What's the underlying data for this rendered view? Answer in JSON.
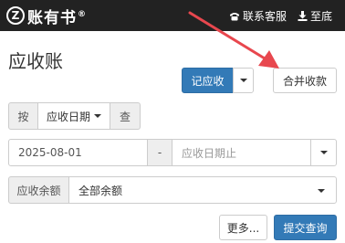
{
  "header": {
    "logo_mark": "Z",
    "logo_text": "账有书",
    "logo_reg": "®",
    "service_label": "联系客服",
    "bottom_label": "至底"
  },
  "page": {
    "title": "应收账"
  },
  "toolbar": {
    "record_label": "记应收",
    "merge_label": "合并收款"
  },
  "filter": {
    "by_label": "按",
    "by_value": "应收日期",
    "check_label": "查",
    "date_start": "2025-08-01",
    "date_dash": "-",
    "date_end_placeholder": "应收日期止",
    "balance_label": "应收余额",
    "balance_value": "全部余额",
    "more_label": "更多...",
    "submit_label": "提交查询"
  },
  "colors": {
    "topbar": "#222222",
    "primary": "#337ab7",
    "arrow": "#e8474e"
  }
}
